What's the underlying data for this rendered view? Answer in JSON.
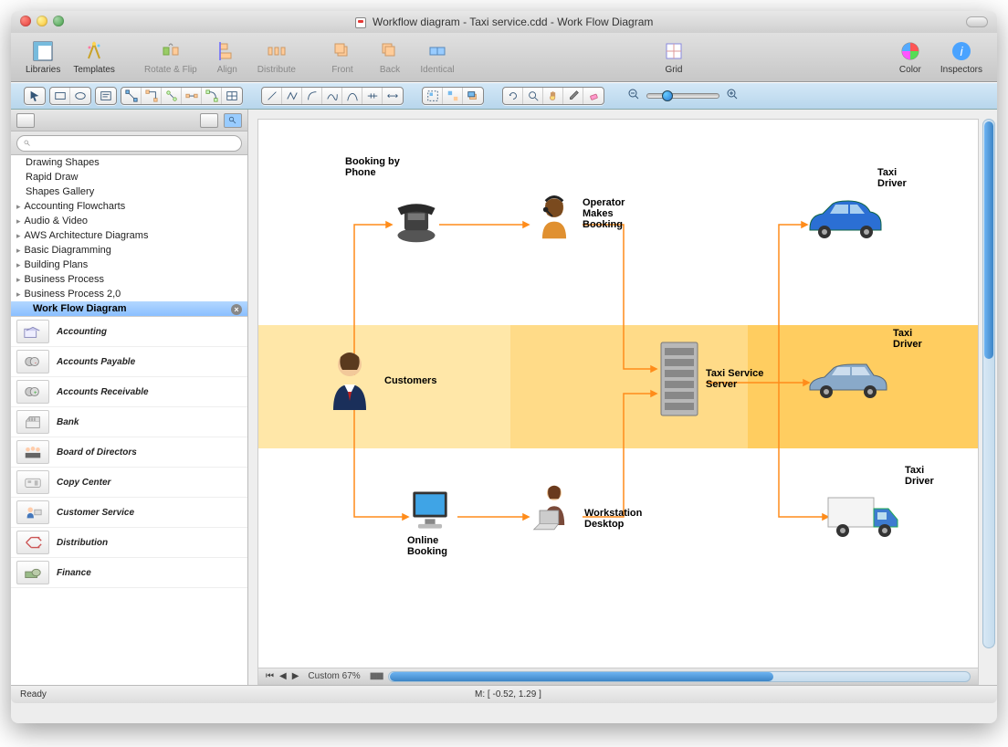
{
  "window": {
    "title": "Workflow diagram - Taxi service.cdd - Work Flow Diagram"
  },
  "toolbar1": {
    "libraries": "Libraries",
    "templates": "Templates",
    "rotate_flip": "Rotate & Flip",
    "align": "Align",
    "distribute": "Distribute",
    "front": "Front",
    "back": "Back",
    "identical": "Identical",
    "grid": "Grid",
    "color": "Color",
    "inspectors": "Inspectors"
  },
  "sidebar": {
    "search_placeholder": "",
    "tree": [
      {
        "label": "Drawing Shapes",
        "cat": false
      },
      {
        "label": "Rapid Draw",
        "cat": false
      },
      {
        "label": "Shapes Gallery",
        "cat": false
      },
      {
        "label": "Accounting Flowcharts",
        "cat": true
      },
      {
        "label": "Audio & Video",
        "cat": true
      },
      {
        "label": "AWS Architecture Diagrams",
        "cat": true
      },
      {
        "label": "Basic Diagramming",
        "cat": true
      },
      {
        "label": "Building Plans",
        "cat": true
      },
      {
        "label": "Business Process",
        "cat": true
      },
      {
        "label": "Business Process 2,0",
        "cat": true
      }
    ],
    "selected": "Work Flow Diagram",
    "shapes": [
      "Accounting",
      "Accounts Payable",
      "Accounts Receivable",
      "Bank",
      "Board of Directors",
      "Copy Center",
      "Customer Service",
      "Distribution",
      "Finance"
    ]
  },
  "canvas": {
    "nodes": {
      "customers": "Customers",
      "booking_phone": "Booking by\nPhone",
      "operator": "Operator\nMakes\nBooking",
      "online": "Online\nBooking",
      "workstation": "Workstation\nDesktop",
      "server": "Taxi Service\nServer",
      "driver1": "Taxi\nDriver",
      "driver2": "Taxi\nDriver",
      "driver3": "Taxi\nDriver"
    }
  },
  "hruler": {
    "zoom_label": "Custom 67%"
  },
  "status": {
    "ready": "Ready",
    "coords": "M: [ -0.52, 1.29 ]"
  }
}
